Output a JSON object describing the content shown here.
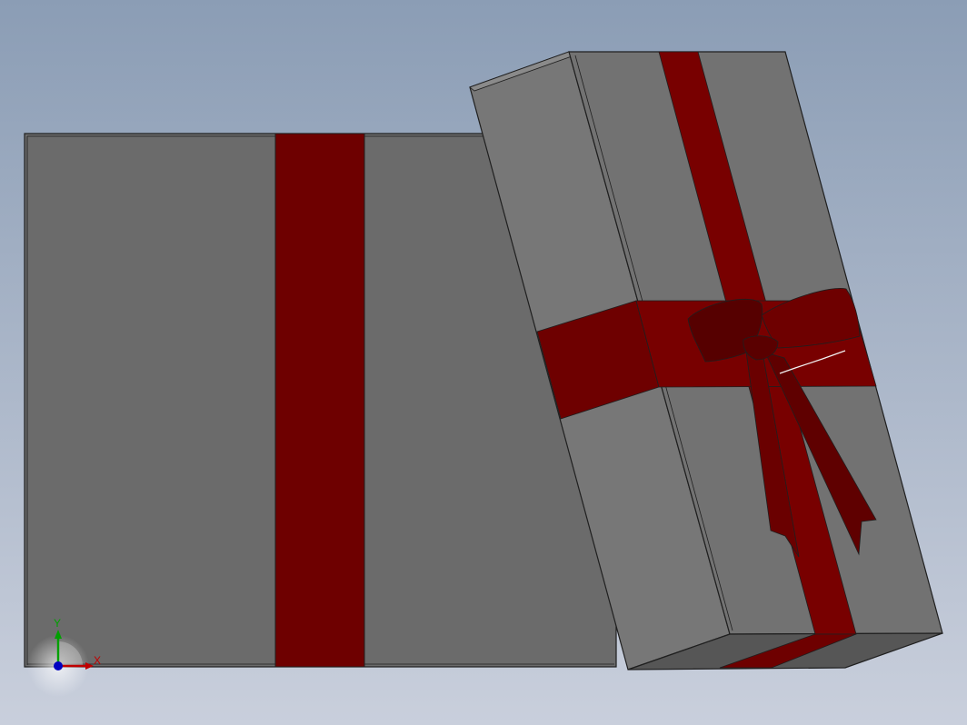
{
  "colors": {
    "background_top": "#8b9db5",
    "background_bottom": "#c9cfdc",
    "box_face": "#6b6b6b",
    "box_face_light": "#777777",
    "box_face_dark": "#565656",
    "edge": "#1f1f1f",
    "ribbon": "#6e0000",
    "ribbon_bright": "#780000",
    "ribbon_dark": "#560000",
    "axis_x": "#c00000",
    "axis_y": "#00a000",
    "axis_z": "#0000c0"
  },
  "triad": {
    "x_label": "X",
    "y_label": "Y"
  }
}
